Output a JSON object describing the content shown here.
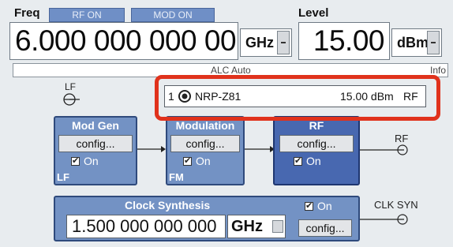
{
  "header": {
    "freq_label": "Freq",
    "rf_on": "RF ON",
    "mod_on": "MOD ON",
    "level_label": "Level",
    "freq_value": "6.000 000 000 00",
    "freq_unit": "GHz",
    "level_value": "15.00",
    "level_unit": "dBm"
  },
  "aux_bar": {
    "center_text": "ALC Auto",
    "right_text": "Info"
  },
  "power_sensor": {
    "channel": "1",
    "name": "NRP-Z81",
    "reading": "15.00 dBm",
    "mode": "RF"
  },
  "lf": {
    "label": "LF"
  },
  "blocks": {
    "mod_gen": {
      "title": "Mod Gen",
      "config": "config...",
      "on": "On",
      "footer": "LF"
    },
    "modulation": {
      "title": "Modulation",
      "config": "config...",
      "on": "On",
      "footer": "FM"
    },
    "rf": {
      "title": "RF",
      "config": "config...",
      "on": "On"
    }
  },
  "rf_out": {
    "label": "RF"
  },
  "clock": {
    "title": "Clock Synthesis",
    "on": "On",
    "value": "1.500 000 000 000",
    "unit": "GHz",
    "config": "config..."
  },
  "clk_out": {
    "label": "CLK SYN"
  },
  "colors": {
    "highlight": "#e0321c",
    "block": "#7392c4",
    "rf_block": "#4868b0"
  }
}
